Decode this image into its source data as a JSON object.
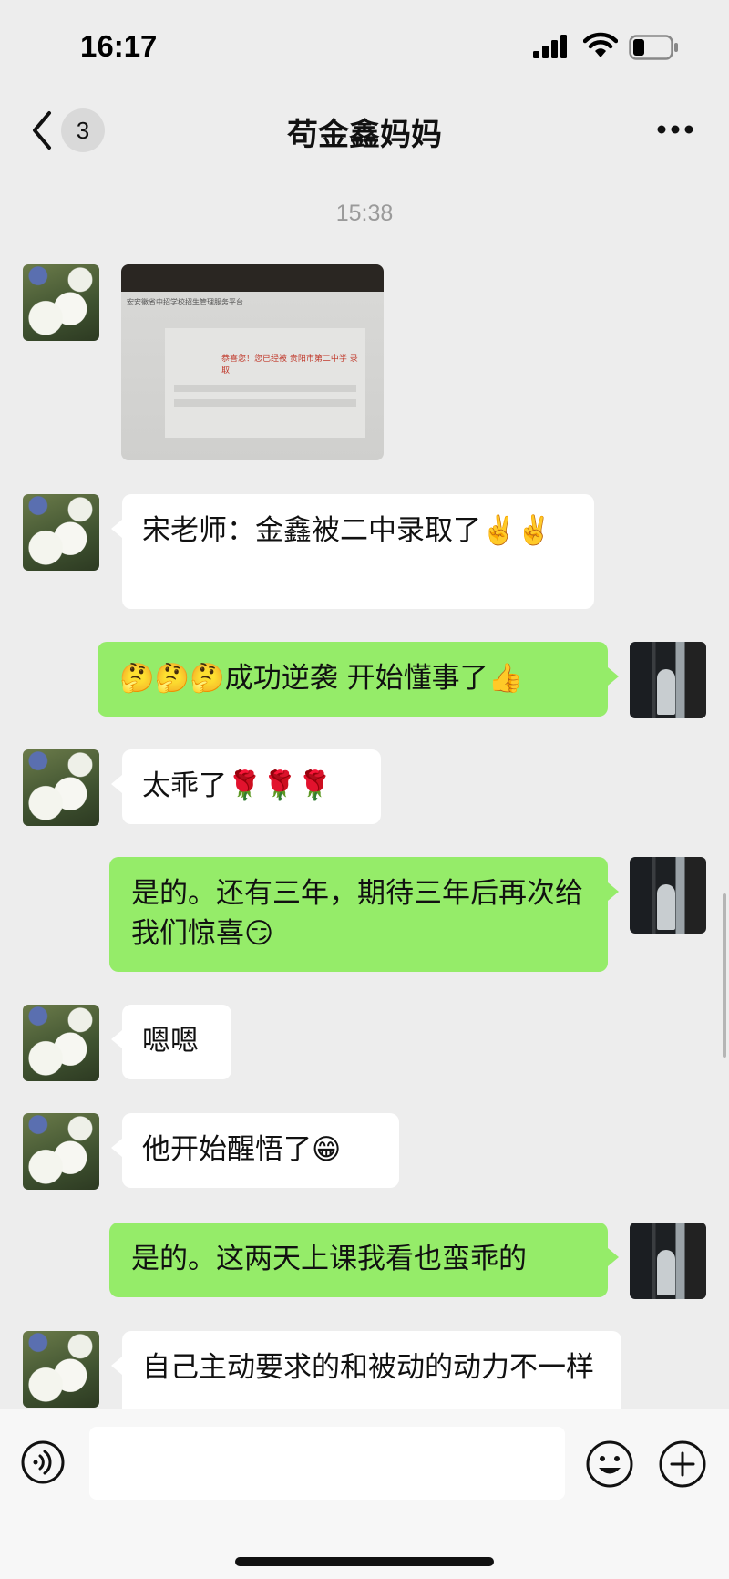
{
  "status": {
    "time": "16:17"
  },
  "nav": {
    "badge": "3",
    "title": "苟金鑫妈妈"
  },
  "chat": {
    "timestamp": "15:38",
    "image_message": {
      "screen_title": "宏安徽省中招学校招生管理服务平台",
      "screen_text": "恭喜您！您已经被 贵阳市第二中学 录取"
    },
    "messages": [
      {
        "side": "left",
        "text": "宋老师：金鑫被二中录取了✌️✌️"
      },
      {
        "side": "right",
        "text": "🤔🤔🤔成功逆袭  开始懂事了👍"
      },
      {
        "side": "left",
        "text": "太乖了🌹🌹🌹"
      },
      {
        "side": "right",
        "text": "是的。还有三年，期待三年后再次给我们惊喜😏"
      },
      {
        "side": "left",
        "text": "嗯嗯"
      },
      {
        "side": "left",
        "text": "他开始醒悟了😁"
      },
      {
        "side": "right",
        "text": "是的。这两天上课我看也蛮乖的"
      },
      {
        "side": "left",
        "text": "自己主动要求的和被动的动力不一样"
      }
    ]
  },
  "input": {
    "value": ""
  },
  "icons": [
    "signal-icon",
    "wifi-icon",
    "battery-icon",
    "back-icon",
    "more-icon",
    "voice-icon",
    "emoji-icon",
    "plus-icon"
  ],
  "colors": {
    "background": "#ededed",
    "bubble_self": "#95ec69",
    "bubble_other": "#ffffff"
  }
}
